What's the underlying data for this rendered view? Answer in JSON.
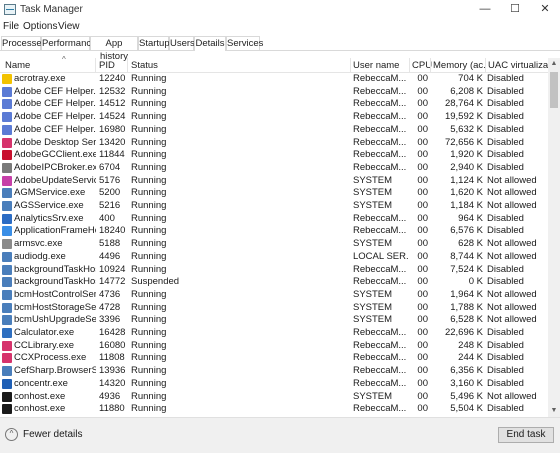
{
  "window": {
    "title": "Task Manager",
    "minimize_icon": "—",
    "maximize_icon": "☐",
    "close_icon": "✕"
  },
  "menu": {
    "file": "File",
    "options": "Options",
    "view": "View"
  },
  "tabs": [
    {
      "label": "Processes"
    },
    {
      "label": "Performance"
    },
    {
      "label": "App history"
    },
    {
      "label": "Startup"
    },
    {
      "label": "Users"
    },
    {
      "label": "Details"
    },
    {
      "label": "Services"
    }
  ],
  "active_tab": "Details",
  "columns": {
    "name": "Name",
    "pid": "PID",
    "status": "Status",
    "user": "User name",
    "cpu": "CPU",
    "memory": "Memory (ac...",
    "uac": "UAC virtualizati..."
  },
  "sort_arrow": "^",
  "rows": [
    {
      "icon": "acrotray",
      "color": "#f2c200",
      "name": "acrotray.exe",
      "pid": "12240",
      "status": "Running",
      "user": "RebeccaM...",
      "cpu": "00",
      "mem": "704 K",
      "uac": "Disabled"
    },
    {
      "icon": "adobe-cef",
      "color": "#5b7bd5",
      "name": "Adobe CEF Helper.exe",
      "pid": "12532",
      "status": "Running",
      "user": "RebeccaM...",
      "cpu": "00",
      "mem": "6,208 K",
      "uac": "Disabled"
    },
    {
      "icon": "adobe-cef",
      "color": "#5b7bd5",
      "name": "Adobe CEF Helper.exe",
      "pid": "14512",
      "status": "Running",
      "user": "RebeccaM...",
      "cpu": "00",
      "mem": "28,764 K",
      "uac": "Disabled"
    },
    {
      "icon": "adobe-cef",
      "color": "#5b7bd5",
      "name": "Adobe CEF Helper.exe",
      "pid": "14524",
      "status": "Running",
      "user": "RebeccaM...",
      "cpu": "00",
      "mem": "19,592 K",
      "uac": "Disabled"
    },
    {
      "icon": "adobe-cef",
      "color": "#5b7bd5",
      "name": "Adobe CEF Helper.exe",
      "pid": "16980",
      "status": "Running",
      "user": "RebeccaM...",
      "cpu": "00",
      "mem": "5,632 K",
      "uac": "Disabled"
    },
    {
      "icon": "adobe-desktop",
      "color": "#d6336c",
      "name": "Adobe Desktop Servi...",
      "pid": "13420",
      "status": "Running",
      "user": "RebeccaM...",
      "cpu": "00",
      "mem": "72,656 K",
      "uac": "Disabled"
    },
    {
      "icon": "adobe-gc",
      "color": "#c8102e",
      "name": "AdobeGCClient.exe",
      "pid": "11844",
      "status": "Running",
      "user": "RebeccaM...",
      "cpu": "00",
      "mem": "1,920 K",
      "uac": "Disabled"
    },
    {
      "icon": "adobe-ipc",
      "color": "#7a7a7a",
      "name": "AdobeIPCBroker.exe",
      "pid": "6704",
      "status": "Running",
      "user": "RebeccaM...",
      "cpu": "00",
      "mem": "2,940 K",
      "uac": "Disabled"
    },
    {
      "icon": "adobe-update",
      "color": "#c63fa8",
      "name": "AdobeUpdateService...",
      "pid": "5176",
      "status": "Running",
      "user": "SYSTEM",
      "cpu": "00",
      "mem": "1,124 K",
      "uac": "Not allowed"
    },
    {
      "icon": "service",
      "color": "#4a7ebb",
      "name": "AGMService.exe",
      "pid": "5200",
      "status": "Running",
      "user": "SYSTEM",
      "cpu": "00",
      "mem": "1,620 K",
      "uac": "Not allowed"
    },
    {
      "icon": "service",
      "color": "#4a7ebb",
      "name": "AGSService.exe",
      "pid": "5216",
      "status": "Running",
      "user": "SYSTEM",
      "cpu": "00",
      "mem": "1,184 K",
      "uac": "Not allowed"
    },
    {
      "icon": "analytics",
      "color": "#2b6cc4",
      "name": "AnalyticsSrv.exe",
      "pid": "400",
      "status": "Running",
      "user": "RebeccaM...",
      "cpu": "00",
      "mem": "964 K",
      "uac": "Disabled"
    },
    {
      "icon": "app-frame",
      "color": "#3a8ee6",
      "name": "ApplicationFrameHo...",
      "pid": "18240",
      "status": "Running",
      "user": "RebeccaM...",
      "cpu": "00",
      "mem": "6,576 K",
      "uac": "Disabled"
    },
    {
      "icon": "armsvc",
      "color": "#8a8a8a",
      "name": "armsvc.exe",
      "pid": "5188",
      "status": "Running",
      "user": "SYSTEM",
      "cpu": "00",
      "mem": "628 K",
      "uac": "Not allowed"
    },
    {
      "icon": "service",
      "color": "#4a7ebb",
      "name": "audiodg.exe",
      "pid": "4496",
      "status": "Running",
      "user": "LOCAL SER...",
      "cpu": "00",
      "mem": "8,744 K",
      "uac": "Not allowed"
    },
    {
      "icon": "service",
      "color": "#4a7ebb",
      "name": "backgroundTaskHost...",
      "pid": "10924",
      "status": "Running",
      "user": "RebeccaM...",
      "cpu": "00",
      "mem": "7,524 K",
      "uac": "Disabled"
    },
    {
      "icon": "service",
      "color": "#4a7ebb",
      "name": "backgroundTaskHost...",
      "pid": "14772",
      "status": "Suspended",
      "user": "RebeccaM...",
      "cpu": "00",
      "mem": "0 K",
      "uac": "Disabled"
    },
    {
      "icon": "service",
      "color": "#4a7ebb",
      "name": "bcmHostControlServi...",
      "pid": "4736",
      "status": "Running",
      "user": "SYSTEM",
      "cpu": "00",
      "mem": "1,964 K",
      "uac": "Not allowed"
    },
    {
      "icon": "service",
      "color": "#4a7ebb",
      "name": "bcmHostStorageServ...",
      "pid": "4728",
      "status": "Running",
      "user": "SYSTEM",
      "cpu": "00",
      "mem": "1,788 K",
      "uac": "Not allowed"
    },
    {
      "icon": "service",
      "color": "#4a7ebb",
      "name": "bcmUshUpgradeServ...",
      "pid": "3396",
      "status": "Running",
      "user": "SYSTEM",
      "cpu": "00",
      "mem": "6,528 K",
      "uac": "Not allowed"
    },
    {
      "icon": "calculator",
      "color": "#2e6fc0",
      "name": "Calculator.exe",
      "pid": "16428",
      "status": "Running",
      "user": "RebeccaM...",
      "cpu": "00",
      "mem": "22,696 K",
      "uac": "Disabled"
    },
    {
      "icon": "cc-library",
      "color": "#d6336c",
      "name": "CCLibrary.exe",
      "pid": "16080",
      "status": "Running",
      "user": "RebeccaM...",
      "cpu": "00",
      "mem": "248 K",
      "uac": "Disabled"
    },
    {
      "icon": "ccx-process",
      "color": "#d6336c",
      "name": "CCXProcess.exe",
      "pid": "11808",
      "status": "Running",
      "user": "RebeccaM...",
      "cpu": "00",
      "mem": "244 K",
      "uac": "Disabled"
    },
    {
      "icon": "service",
      "color": "#4a7ebb",
      "name": "CefSharp.BrowserSub...",
      "pid": "13936",
      "status": "Running",
      "user": "RebeccaM...",
      "cpu": "00",
      "mem": "6,356 K",
      "uac": "Disabled"
    },
    {
      "icon": "concentr",
      "color": "#1f5fb5",
      "name": "concentr.exe",
      "pid": "14320",
      "status": "Running",
      "user": "RebeccaM...",
      "cpu": "00",
      "mem": "3,160 K",
      "uac": "Disabled"
    },
    {
      "icon": "conhost",
      "color": "#1a1a1a",
      "name": "conhost.exe",
      "pid": "4936",
      "status": "Running",
      "user": "SYSTEM",
      "cpu": "00",
      "mem": "5,496 K",
      "uac": "Not allowed"
    },
    {
      "icon": "conhost",
      "color": "#1a1a1a",
      "name": "conhost.exe",
      "pid": "11880",
      "status": "Running",
      "user": "RebeccaM...",
      "cpu": "00",
      "mem": "5,504 K",
      "uac": "Disabled"
    }
  ],
  "footer": {
    "fewer_details": "Fewer details",
    "fewer_icon": "^",
    "end_task": "End task"
  },
  "scrollbar": {
    "up": "▲",
    "down": "▼"
  }
}
